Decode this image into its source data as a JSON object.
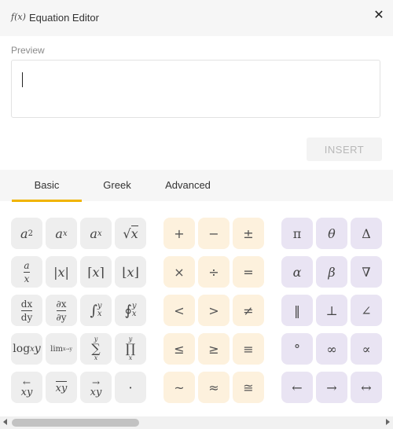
{
  "header": {
    "icon": "f(x)",
    "title": "Equation Editor",
    "close_icon": "close-icon"
  },
  "preview": {
    "label": "Preview",
    "value": ""
  },
  "actions": {
    "insert_label": "INSERT"
  },
  "tabs": [
    {
      "label": "Basic",
      "active": true
    },
    {
      "label": "Greek",
      "active": false
    },
    {
      "label": "Advanced",
      "active": false
    }
  ],
  "operators": [
    "+",
    "−",
    "±",
    "×",
    "÷",
    "=",
    "<",
    ">",
    "≠",
    "≤",
    "≥",
    "≡",
    "~",
    "≈",
    "≅"
  ],
  "greek": [
    "π",
    "θ",
    "Δ",
    "α",
    "β",
    "∇",
    "‖",
    "⊥",
    "∠",
    "°",
    "∞",
    "∝",
    "←",
    "→",
    "↔"
  ],
  "colors": {
    "accent": "#f0b400",
    "basic_bg": "#eeeeee",
    "operator_bg": "#fdf1dd",
    "greek_bg": "#e9e4f3"
  }
}
